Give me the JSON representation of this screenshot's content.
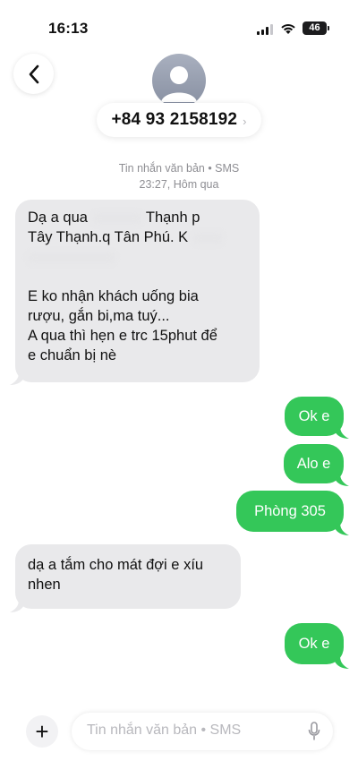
{
  "status_bar": {
    "time": "16:13",
    "network": "4G",
    "network_badge": "46"
  },
  "header": {
    "contact_phone": "+84 93 2158192",
    "chevron": "›"
  },
  "thread_meta": {
    "channel": "Tin nhắn văn bản • SMS",
    "timestamp": "23:27, Hôm qua"
  },
  "messages": [
    {
      "direction": "incoming",
      "lines": [
        "Dạ a qua",
        "Thạnh p",
        "Tây Thạnh.q Tân Phú. K"
      ],
      "body": [
        "E ko nhận khách uống bia",
        "rượu, gắn bi,ma tuý...",
        "A qua thì hẹn e trc 15phut để",
        "e chuẩn bị nè"
      ]
    },
    {
      "direction": "outgoing",
      "text": "Ok e"
    },
    {
      "direction": "outgoing",
      "text": "Alo e"
    },
    {
      "direction": "outgoing",
      "text": "Phòng 305"
    },
    {
      "direction": "incoming",
      "lines": [
        "dạ a tắm cho mát đợi e xíu",
        "nhen"
      ]
    },
    {
      "direction": "outgoing",
      "text": "Ok e"
    }
  ],
  "composer": {
    "placeholder": "Tin nhắn văn bản • SMS",
    "plus": "+"
  },
  "colors": {
    "outgoing": "#34c759",
    "incoming": "#e9e9eb",
    "meta": "#8e8e93"
  }
}
